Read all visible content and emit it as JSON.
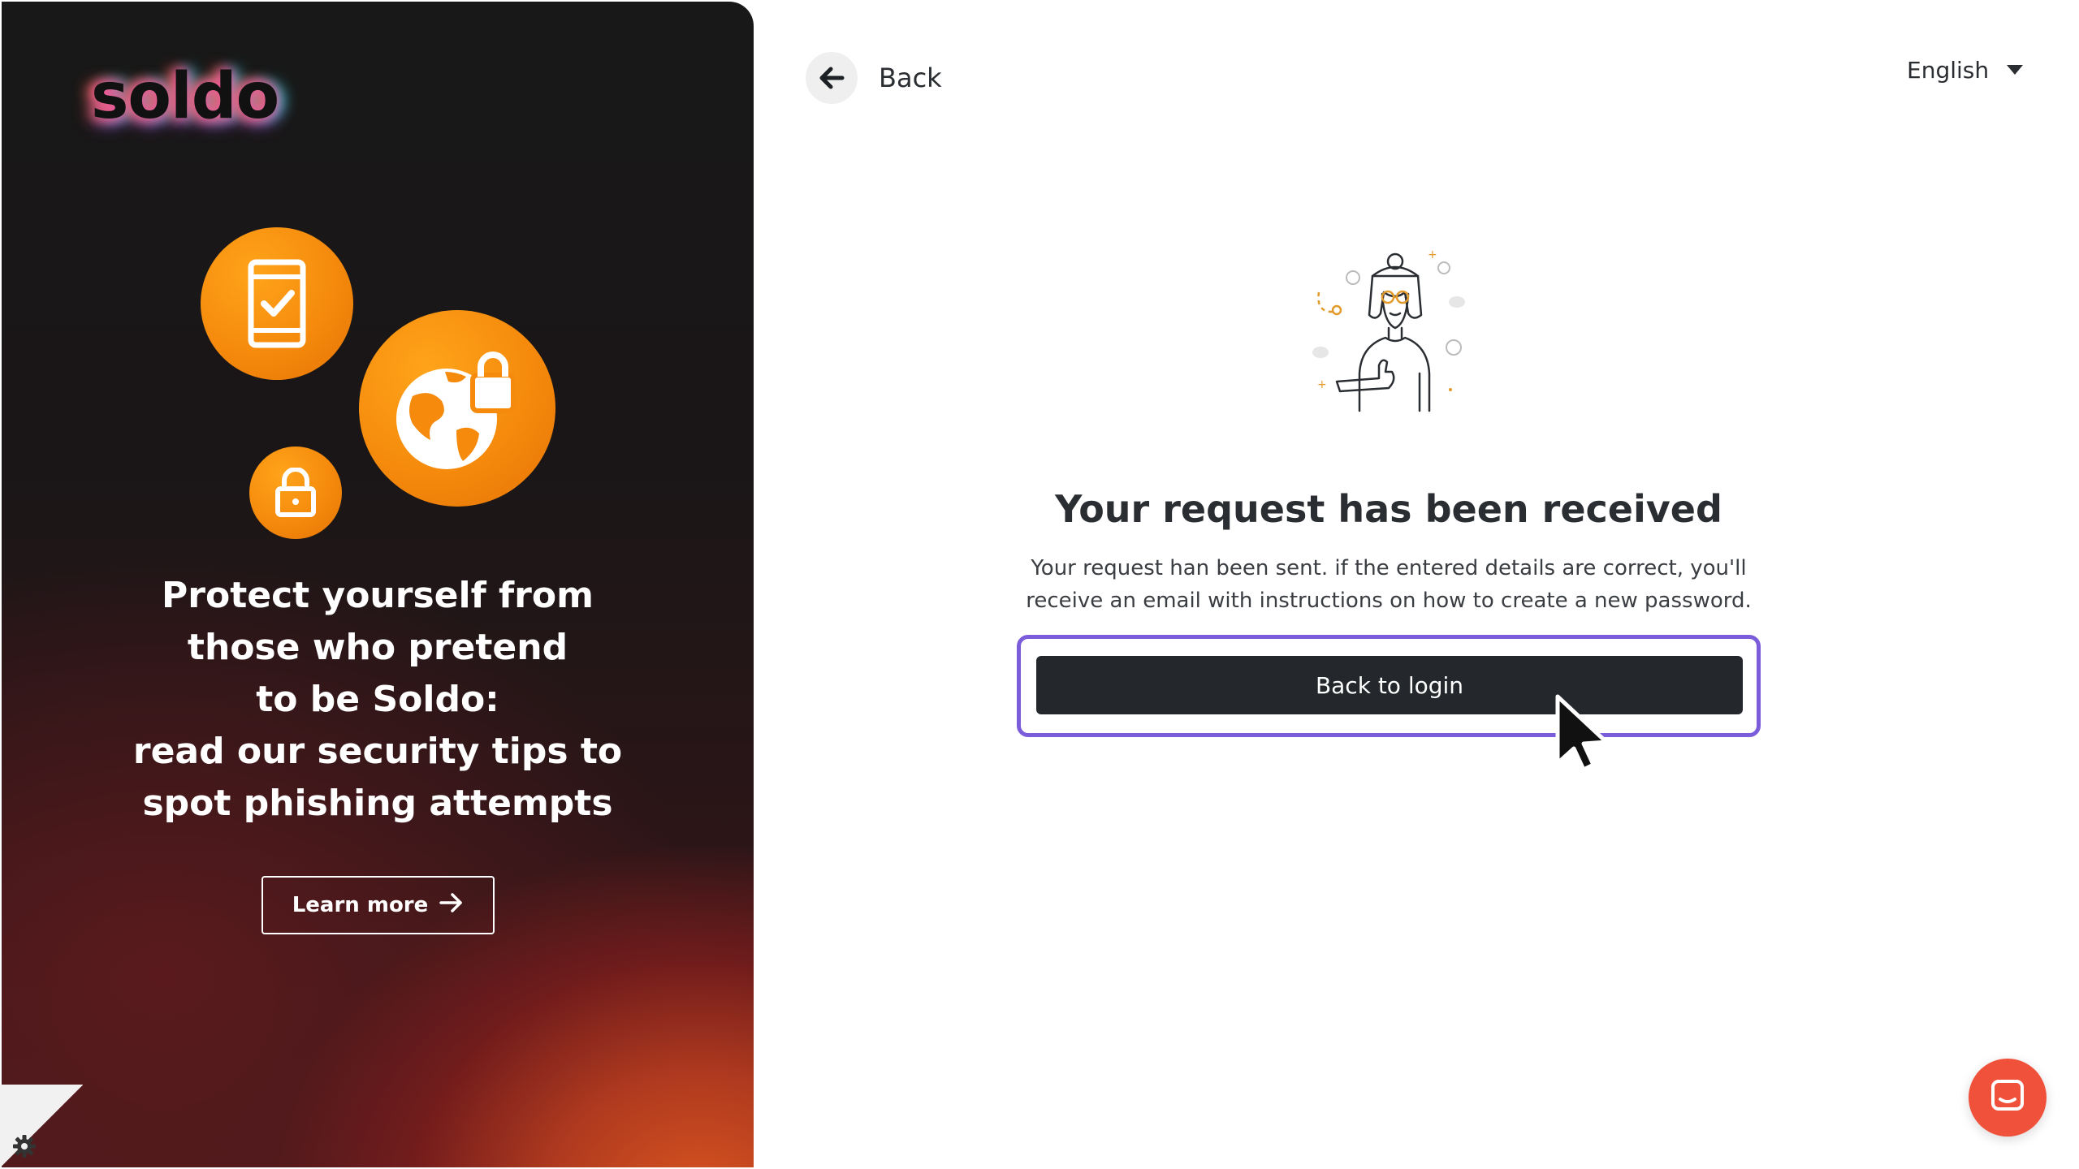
{
  "brand": {
    "logo_text": "soldo"
  },
  "promo": {
    "headline_lines": [
      "Protect yourself from",
      "those who pretend",
      "to be Soldo:",
      "read our security tips to",
      "spot phishing attempts"
    ],
    "learn_more_label": "Learn more",
    "icons": [
      "phone-check-icon",
      "globe-lock-icon",
      "lock-icon"
    ],
    "accent_color": "#f58a0c"
  },
  "header": {
    "back_label": "Back",
    "language": {
      "selected": "English"
    }
  },
  "confirmation": {
    "title": "Your request has been received",
    "description_lines": [
      "Your request han been sent. if the entered details are correct, you'll",
      "receive an email with instructions on how to create a new password."
    ],
    "button_label": "Back to login",
    "button_color": "#24282d",
    "focus_ring_color": "#7b5cdb"
  },
  "support": {
    "chat_icon": "chat-icon",
    "chat_color": "#f0513a"
  },
  "settings": {
    "icon": "gear-icon"
  }
}
